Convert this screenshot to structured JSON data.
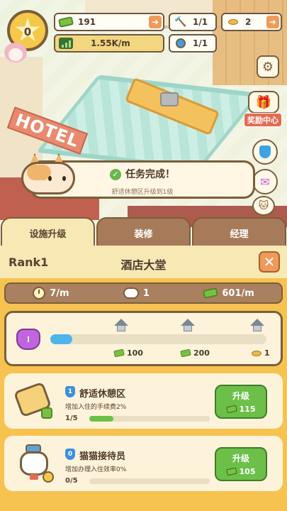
{
  "hud": {
    "level": "0",
    "cash": "191",
    "income_rate": "1.55K/m",
    "hammers": "1/1",
    "potions": "1/1",
    "fish": "2"
  },
  "side": {
    "reward_center_label": "奖励中心"
  },
  "scene": {
    "hotel_sign": "HOTEL"
  },
  "toast": {
    "title": "任务完成！",
    "subtitle": "舒适休憩区升级到1级"
  },
  "tabs": [
    {
      "label": "设施升级",
      "active": true
    },
    {
      "label": "装修",
      "active": false
    },
    {
      "label": "经理",
      "active": false
    }
  ],
  "panel": {
    "rank": "Rank1",
    "title": "酒店大堂",
    "close_glyph": "✕"
  },
  "stats": {
    "time_rate": "7/m",
    "cats": "1",
    "money_rate": "601/m"
  },
  "progress": {
    "crown_level": "I",
    "fill_fraction": 0.1,
    "rewards": [
      {
        "amount": "100",
        "type": "cash"
      },
      {
        "amount": "200",
        "type": "cash"
      },
      {
        "amount": "1",
        "type": "fish"
      }
    ]
  },
  "items": [
    {
      "level": "1",
      "name": "舒适休憩区",
      "desc": "增加入住的手续费2%",
      "count": "1/5",
      "fill_fraction": 0.2,
      "button_label": "升级",
      "cost": "115"
    },
    {
      "level": "0",
      "name": "猫猫接待员",
      "desc": "增加办理入住效率0%",
      "count": "0/5",
      "fill_fraction": 0,
      "button_label": "升级",
      "cost": "105"
    }
  ],
  "colors": {
    "accent_orange": "#ef9a58",
    "upgrade_green": "#6cc04a",
    "panel_yellow": "#f6c350",
    "progress_blue": "#4fb4ea"
  }
}
